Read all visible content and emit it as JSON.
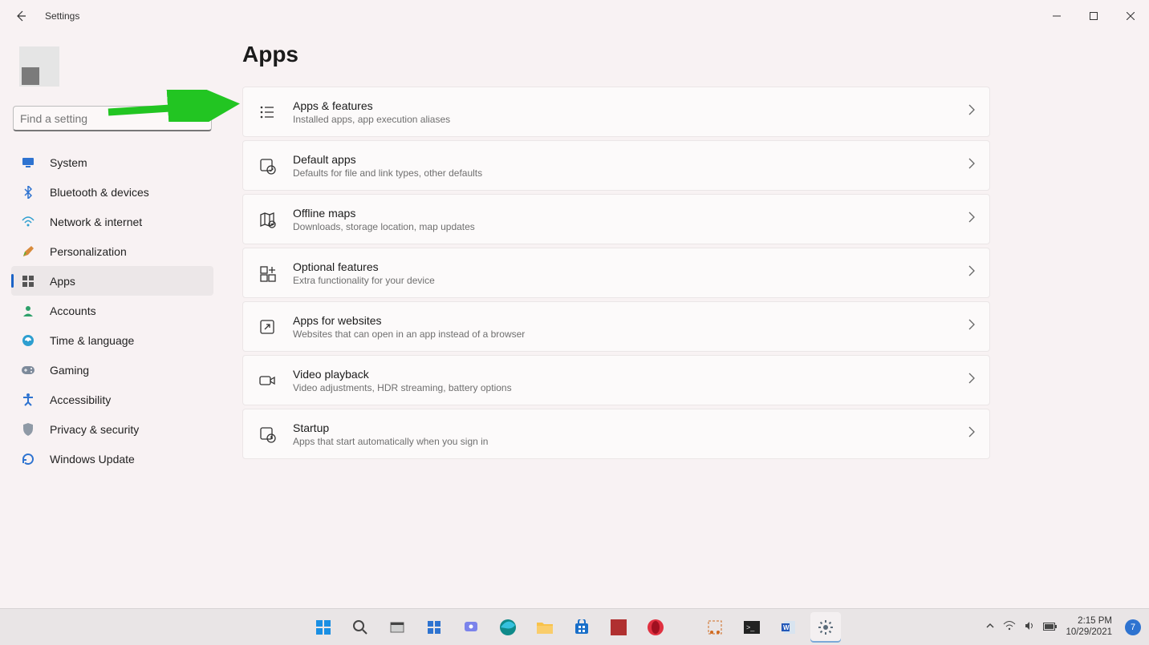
{
  "window": {
    "title": "Settings"
  },
  "page": {
    "title": "Apps"
  },
  "search": {
    "placeholder": "Find a setting"
  },
  "sidebar": {
    "items": [
      {
        "label": "System",
        "icon": "system",
        "color": "#2e73d0"
      },
      {
        "label": "Bluetooth & devices",
        "icon": "bluetooth",
        "color": "#2e73d0"
      },
      {
        "label": "Network & internet",
        "icon": "network",
        "color": "#2e9fd0"
      },
      {
        "label": "Personalization",
        "icon": "personalization",
        "color": "#c97f3a"
      },
      {
        "label": "Apps",
        "icon": "apps",
        "color": "#555",
        "selected": true
      },
      {
        "label": "Accounts",
        "icon": "accounts",
        "color": "#2ea06a"
      },
      {
        "label": "Time & language",
        "icon": "time",
        "color": "#2e9fd0"
      },
      {
        "label": "Gaming",
        "icon": "gaming",
        "color": "#7d8a9a"
      },
      {
        "label": "Accessibility",
        "icon": "accessibility",
        "color": "#2e73d0"
      },
      {
        "label": "Privacy & security",
        "icon": "privacy",
        "color": "#8f9aa6"
      },
      {
        "label": "Windows Update",
        "icon": "update",
        "color": "#2e73d0"
      }
    ]
  },
  "cards": [
    {
      "title": "Apps & features",
      "sub": "Installed apps, app execution aliases",
      "icon": "list"
    },
    {
      "title": "Default apps",
      "sub": "Defaults for file and link types, other defaults",
      "icon": "defaultapp"
    },
    {
      "title": "Offline maps",
      "sub": "Downloads, storage location, map updates",
      "icon": "map"
    },
    {
      "title": "Optional features",
      "sub": "Extra functionality for your device",
      "icon": "optional"
    },
    {
      "title": "Apps for websites",
      "sub": "Websites that can open in an app instead of a browser",
      "icon": "websites"
    },
    {
      "title": "Video playback",
      "sub": "Video adjustments, HDR streaming, battery options",
      "icon": "video"
    },
    {
      "title": "Startup",
      "sub": "Apps that start automatically when you sign in",
      "icon": "startup"
    }
  ],
  "taskbar": {
    "time": "2:15 PM",
    "date": "10/29/2021",
    "badge": "7"
  }
}
